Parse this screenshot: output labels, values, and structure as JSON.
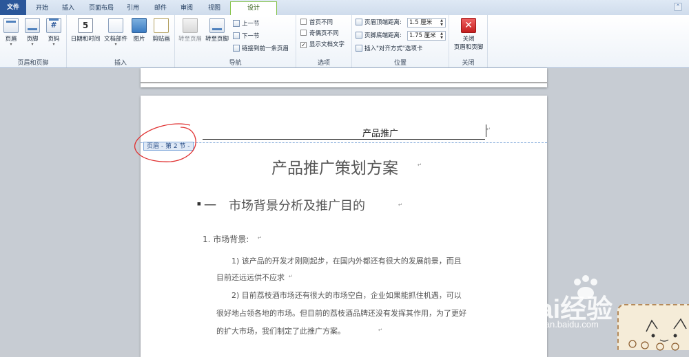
{
  "tabs": [
    "文件",
    "开始",
    "插入",
    "页面布局",
    "引用",
    "邮件",
    "审阅",
    "视图",
    "设计"
  ],
  "ribbon": {
    "group1": {
      "label": "页眉和页脚",
      "buttons": [
        "页眉",
        "页脚",
        "页码"
      ]
    },
    "group2": {
      "label": "插入",
      "buttons": [
        "日期和时间",
        "文档部件",
        "图片",
        "剪贴画"
      ]
    },
    "group3": {
      "label": "导航",
      "buttons": [
        "转至页眉",
        "转至页脚"
      ],
      "prev": "上一节",
      "next": "下一节",
      "link": "链接到前一条页眉"
    },
    "group4": {
      "label": "选项",
      "first_page": "首页不同",
      "odd_even": "奇偶页不同",
      "show_text": "显示文档文字",
      "show_text_checked": true
    },
    "group5": {
      "label": "位置",
      "header_dist_label": "页眉顶端距离:",
      "header_dist_value": "1.5 厘米",
      "footer_dist_label": "页脚底端距离:",
      "footer_dist_value": "1.75 厘米",
      "align_tab": "插入\"对齐方式\"选项卡"
    },
    "group6": {
      "label": "关闭",
      "close_label1": "关闭",
      "close_label2": "页眉和页脚"
    }
  },
  "document": {
    "header_text": "产品推广",
    "header_tag": "页眉 - 第 2 节 -",
    "title": "产品推广策划方案",
    "heading1": "一　市场背景分析及推广目的",
    "list1": "1.  市场背景:",
    "para1_line1": "1)  该产品的开发才刚刚起步，在国内外都还有很大的发展前景，而且",
    "para1_line2": "目前还远远供不应求",
    "para2_line1": "2)  目前荔枝酒市场还有很大的市场空白，企业如果能抓住机遇，可以",
    "para2_line2": "很好地占领各地的市场。但目前的荔枝酒品牌还没有发挥其作用，为了更好",
    "para2_line3": "的扩大市场，我们制定了此推广方案。",
    "para_mark": "↵"
  },
  "watermark": {
    "brand": "Bai经验",
    "url": "jingyan.baidu.com"
  },
  "colors": {
    "file_tab": "#2b579a",
    "design_tab_border": "#86c34a",
    "annotation": "#e03030"
  }
}
